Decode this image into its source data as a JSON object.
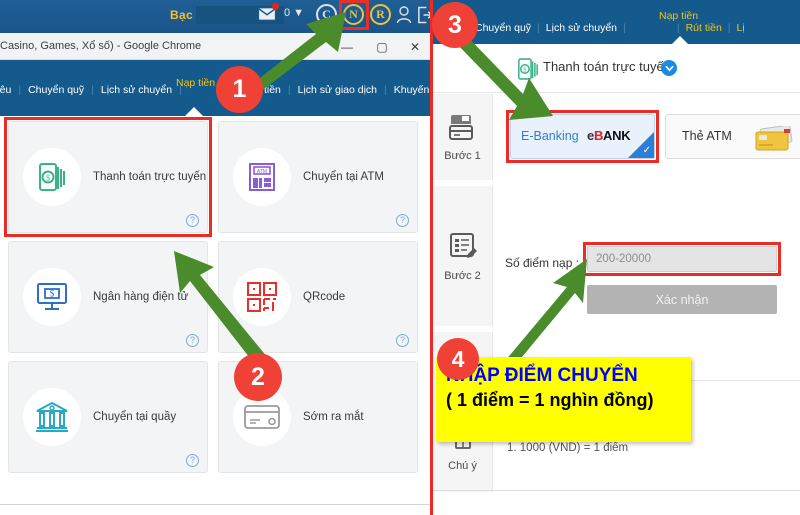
{
  "left_window": {
    "game_topbar": {
      "currency_label": "Bạc",
      "balance_value": "",
      "message_count": "0 ▼",
      "icons": [
        "envelope-icon",
        "c-badge-icon",
        "n-badge-icon",
        "r-badge-icon",
        "person-icon",
        "logout-icon"
      ],
      "badge_c": "C",
      "badge_n": "N",
      "badge_r": "R"
    },
    "chrome": {
      "title": "Casino, Games, Xổ số) - Google Chrome",
      "minimize": "—",
      "maximize": "▢",
      "close": "✕"
    },
    "site_nav": {
      "items": [
        "liêu",
        "Chuyển quỹ",
        "Lịch sử chuyển",
        "Nạp tiền",
        "Rút tiền",
        "Lịch sử giao dịch",
        "Khuyến mã"
      ],
      "active": "Nạp tiền"
    },
    "cards": [
      {
        "label": "Thanh toán trực tuyến",
        "icon": "mobile-money-icon",
        "help": "?"
      },
      {
        "label": "Chuyển tại ATM",
        "icon": "atm-machine-icon",
        "help": "?"
      },
      {
        "label": "Ngân hàng điện tử",
        "icon": "monitor-dollar-icon",
        "help": "?"
      },
      {
        "label": "QRcode",
        "icon": "qrcode-icon",
        "help": "?"
      },
      {
        "label": "Chuyển tại quầy",
        "icon": "bank-building-icon",
        "help": "?"
      },
      {
        "label": "Sớm ra mắt",
        "icon": "credit-card-icon",
        "help": ""
      }
    ]
  },
  "right_window": {
    "nav": {
      "items": [
        "Chuyển quỹ",
        "Lịch sử chuyển",
        "Nạp tiền",
        "Rút tiền",
        "Lị"
      ],
      "active": "Nạp tiền"
    },
    "header": {
      "title": "Thanh toán trực tuyến",
      "badge_icon": "chevron-down-circle-icon"
    },
    "step1": {
      "rail_label": "Bước 1",
      "rail_icon": "card-stack-icon",
      "options": [
        {
          "label": "E-Banking",
          "logo_prefix": "e",
          "logo_b": "B",
          "logo_rest": "ANK",
          "selected": true
        },
        {
          "label": "Thẻ ATM",
          "icon": "atm-cards-icon",
          "selected": false
        }
      ]
    },
    "step2": {
      "rail_label": "Bước 2",
      "rail_icon": "form-edit-icon",
      "field_label": "Số điểm nạp :",
      "field_value": "",
      "field_placeholder": "200-20000",
      "confirm_label": "Xác nhận"
    },
    "step3": {
      "rail_label": "Chú ý",
      "rail_icon": "note-icon",
      "notes": [
        "1.  1000 (VND) = 1 điểm"
      ]
    }
  },
  "annotations": {
    "badges": [
      "1",
      "2",
      "3",
      "4"
    ],
    "callout": {
      "line1": "NHẬP ĐIỂM CHUYỂN",
      "line2": "( 1 điểm = 1 nghìn đồng)",
      "line1_color": "#0000ff",
      "line2_color": "#000000",
      "background": "#ffff00"
    },
    "highlight_color": "#ee2a24",
    "arrow_color": "#4a8b2c",
    "badge_color": "#ef4136"
  }
}
